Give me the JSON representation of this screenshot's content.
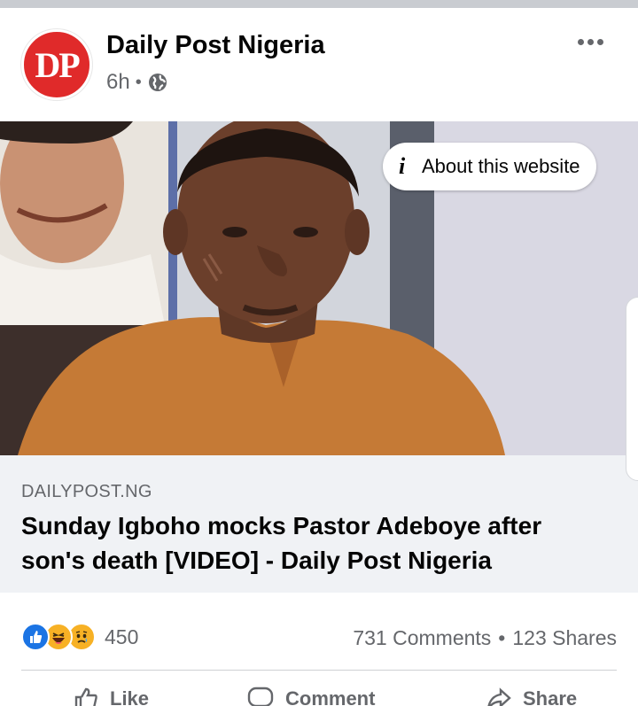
{
  "post": {
    "page_name": "Daily Post Nigeria",
    "avatar_text": "DP",
    "time": "6h",
    "audience_icon": "globe-icon",
    "more_icon": "more-options-icon"
  },
  "link_preview": {
    "about_label": "About this website",
    "domain": "DAILYPOST.NG",
    "headline": "Sunday Igboho mocks Pastor Adeboye after son's death [VIDEO] - Daily Post Nigeria"
  },
  "stats": {
    "reactions": [
      "like",
      "haha",
      "sad"
    ],
    "reaction_count": "450",
    "comments": "731 Comments",
    "separator": "•",
    "shares": "123 Shares"
  },
  "actions": {
    "like": "Like",
    "comment": "Comment",
    "share": "Share"
  },
  "colors": {
    "brand_red": "#e02a2a",
    "like_blue": "#1b74e4",
    "reaction_yellow": "#f7b125",
    "muted_text": "#65676b"
  }
}
